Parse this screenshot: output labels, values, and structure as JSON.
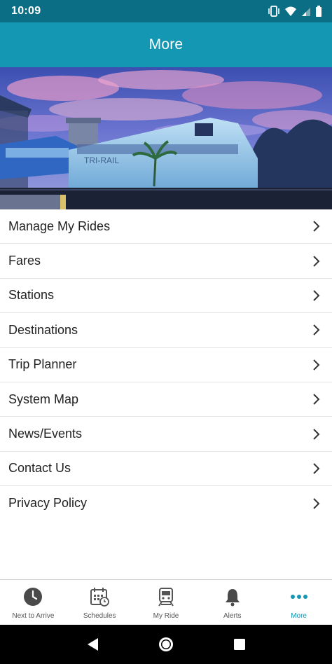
{
  "status_bar": {
    "time": "10:09",
    "icons": [
      "vibrate-icon",
      "wifi-icon",
      "signal-icon",
      "battery-icon"
    ]
  },
  "app_bar": {
    "title": "More"
  },
  "hero": {
    "image": "tri-rail-train-photo"
  },
  "menu": {
    "items": [
      {
        "label": "Manage My Rides"
      },
      {
        "label": "Fares"
      },
      {
        "label": "Stations"
      },
      {
        "label": "Destinations"
      },
      {
        "label": "Trip Planner"
      },
      {
        "label": "System Map"
      },
      {
        "label": "News/Events"
      },
      {
        "label": "Contact Us"
      },
      {
        "label": "Privacy Policy"
      }
    ]
  },
  "bottom_nav": {
    "items": [
      {
        "label": "Next to Arrive",
        "icon": "clock-icon",
        "active": false
      },
      {
        "label": "Schedules",
        "icon": "calendar-icon",
        "active": false
      },
      {
        "label": "My Ride",
        "icon": "train-icon",
        "active": false
      },
      {
        "label": "Alerts",
        "icon": "bell-icon",
        "active": false
      },
      {
        "label": "More",
        "icon": "more-dots-icon",
        "active": true
      }
    ]
  },
  "colors": {
    "status_bar": "#0c6e84",
    "app_bar": "#1497b3",
    "accent": "#1497b3"
  }
}
